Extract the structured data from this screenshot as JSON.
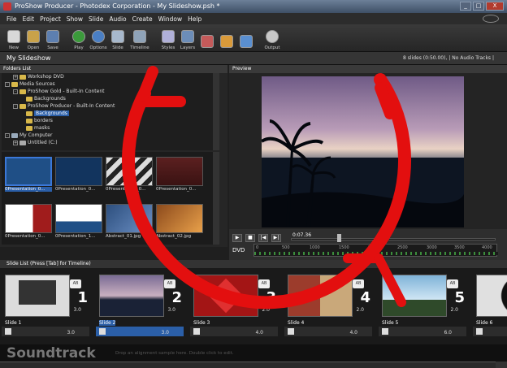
{
  "window": {
    "title": "ProShow Producer - Photodex Corporation - My Slideshow.psh *",
    "controls": [
      "_",
      "□",
      "X"
    ]
  },
  "menu": [
    "File",
    "Edit",
    "Project",
    "Show",
    "Slide",
    "Audio",
    "Create",
    "Window",
    "Help"
  ],
  "toolbar": [
    {
      "label": "New",
      "icon": "new-icon"
    },
    {
      "label": "Open",
      "icon": "open-icon"
    },
    {
      "label": "Save",
      "icon": "save-icon"
    },
    {
      "label": "Play",
      "icon": "play-icon"
    },
    {
      "label": "Options",
      "icon": "options-icon"
    },
    {
      "label": "Slide",
      "icon": "slide-icon"
    },
    {
      "label": "Timeline",
      "icon": "timeline-icon"
    },
    {
      "label": "Styles",
      "icon": "styles-icon"
    },
    {
      "label": "Layers",
      "icon": "layers-icon"
    },
    {
      "label": "Output",
      "icon": "output-icon"
    }
  ],
  "project": {
    "name": "My Slideshow",
    "info": "8 slides (0:50.00), | No Audio Tracks |"
  },
  "folders": {
    "header": "Folders List",
    "items": [
      {
        "label": "Workshop DVD",
        "level": 1
      },
      {
        "label": "Media Sources",
        "level": 0
      },
      {
        "label": "ProShow Gold - Built-In Content",
        "level": 1
      },
      {
        "label": "Backgrounds",
        "level": 2
      },
      {
        "label": "ProShow Producer - Built-In Content",
        "level": 1
      },
      {
        "label": "Backgrounds",
        "level": 2,
        "selected": true
      },
      {
        "label": "borders",
        "level": 2
      },
      {
        "label": "masks",
        "level": 2
      },
      {
        "label": "My Computer",
        "level": 0
      },
      {
        "label": "Untitled (C:)",
        "level": 1
      }
    ]
  },
  "files": [
    {
      "name": "0Presentation_0...",
      "color": "#1f4f86",
      "selected": true
    },
    {
      "name": "0Presentation_0...",
      "color": "#12345e"
    },
    {
      "name": "0Presentation_0...",
      "color": "#3a3a3a"
    },
    {
      "name": "0Presentation_0...",
      "color": "#5c2020"
    },
    {
      "name": "0Presentation_0...",
      "color": "#b8bcc4"
    },
    {
      "name": "0Presentation_1...",
      "color": "#c9ccd2"
    },
    {
      "name": "Abstract_01.jpg",
      "color": "#3a5a8a"
    },
    {
      "name": "Abstract_02.jpg",
      "color": "#b86d2a"
    }
  ],
  "preview": {
    "header": "Preview",
    "time": "0:07.36",
    "format": "DVD",
    "ticks": [
      "0",
      "500",
      "1000",
      "1500",
      "2000",
      "2500",
      "3000",
      "3500",
      "4000"
    ]
  },
  "slidelist": {
    "header": "Slide List (Press [Tab] for Timeline)",
    "slides": [
      {
        "name": "Slide 1",
        "num": "1",
        "trans": "3.0",
        "dur": "3.0",
        "color": "#dcdcdc",
        "selected": false
      },
      {
        "name": "Slide 2",
        "num": "2",
        "trans": "3.0",
        "dur": "3.0",
        "color": "#7a6b94",
        "selected": true
      },
      {
        "name": "Slide 3",
        "num": "3",
        "trans": "2.0",
        "dur": "4.0",
        "color": "#a31515",
        "selected": false
      },
      {
        "name": "Slide 4",
        "num": "4",
        "trans": "2.0",
        "dur": "4.0",
        "color": "#9c3c2c",
        "selected": false
      },
      {
        "name": "Slide 5",
        "num": "5",
        "trans": "2.0",
        "dur": "6.0",
        "color": "#7fb3d8",
        "selected": false
      },
      {
        "name": "Slide 6",
        "num": "",
        "trans": "",
        "dur": "",
        "color": "#e0e0e0",
        "selected": false
      }
    ]
  },
  "soundtrack": {
    "label": "Soundtrack",
    "hint": "Drop an alignment sample here. Double click to edit."
  },
  "colors": {
    "accent": "#2b5fa8",
    "annotation": "#e30f0f"
  }
}
